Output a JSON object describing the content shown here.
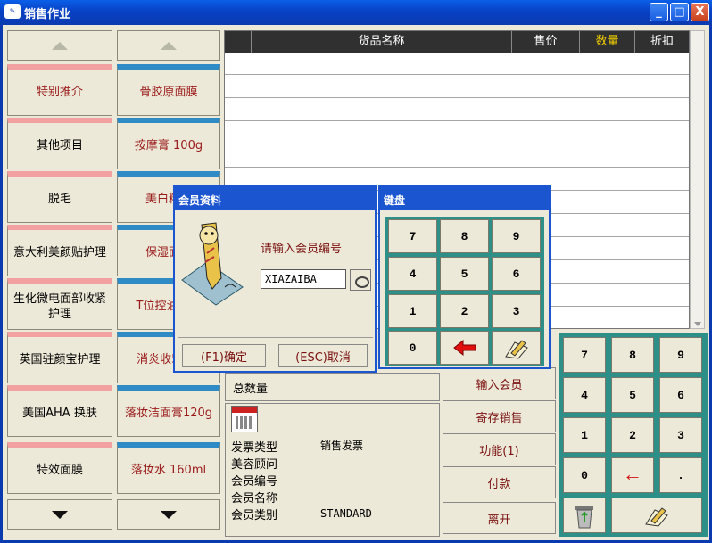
{
  "window": {
    "title": "销售作业",
    "icon": "app-icon",
    "minimize_label": "_",
    "maximize_label": "□",
    "close_label": "X"
  },
  "categories_left": [
    {
      "label": "特别推介",
      "highlight": true
    },
    {
      "label": "其他项目"
    },
    {
      "label": "脱毛"
    },
    {
      "label": "意大利美颜贴护理"
    },
    {
      "label": "生化微电面部收紧护理"
    },
    {
      "label": "英国驻颜宝护理"
    },
    {
      "label": "美国AHA 换肤"
    },
    {
      "label": "特效面膜"
    }
  ],
  "categories_right": [
    {
      "label": "骨胶原面膜"
    },
    {
      "label": "按摩膏 100g"
    },
    {
      "label": "美白精华"
    },
    {
      "label": "保湿面膜"
    },
    {
      "label": "T位控油孔组"
    },
    {
      "label": "消炎收50ml"
    },
    {
      "label": "落妆洁面膏120g"
    },
    {
      "label": "落妆水 160ml"
    }
  ],
  "table": {
    "columns": [
      "货品名称",
      "售价",
      "数量",
      "折扣"
    ]
  },
  "summary": {
    "total_qty_label": "总数量"
  },
  "info": {
    "rows": [
      {
        "label": "发票类型",
        "value": "销售发票"
      },
      {
        "label": "美容顾问",
        "value": ""
      },
      {
        "label": "会员编号",
        "value": ""
      },
      {
        "label": "会员名称",
        "value": ""
      },
      {
        "label": "会员类别",
        "value": "STANDARD"
      }
    ]
  },
  "actions": {
    "enter_member": "输入会员",
    "deposit_sale": "寄存销售",
    "functions": "功能(1)",
    "payment": "付款",
    "exit": "离开"
  },
  "keypad": {
    "keys": [
      "7",
      "8",
      "9",
      "4",
      "5",
      "6",
      "1",
      "2",
      "3",
      "0",
      "←",
      "."
    ]
  },
  "keyboard_dialog": {
    "title": "键盘",
    "keys": [
      "7",
      "8",
      "9",
      "4",
      "5",
      "6",
      "1",
      "2",
      "3",
      "0"
    ]
  },
  "member_dialog": {
    "title": "会员资料",
    "prompt": "请输入会员编号",
    "member_id_value": "XIAZAIBA",
    "ok_label": "(F1)确定",
    "cancel_label": "(ESC)取消"
  },
  "colors": {
    "title_blue": "#0841c5",
    "teal_keypad": "#2e8f88",
    "pink_tab": "#f2a0a0",
    "blue_tab": "#2f8bc6",
    "accent_red": "#9a1a1a"
  }
}
